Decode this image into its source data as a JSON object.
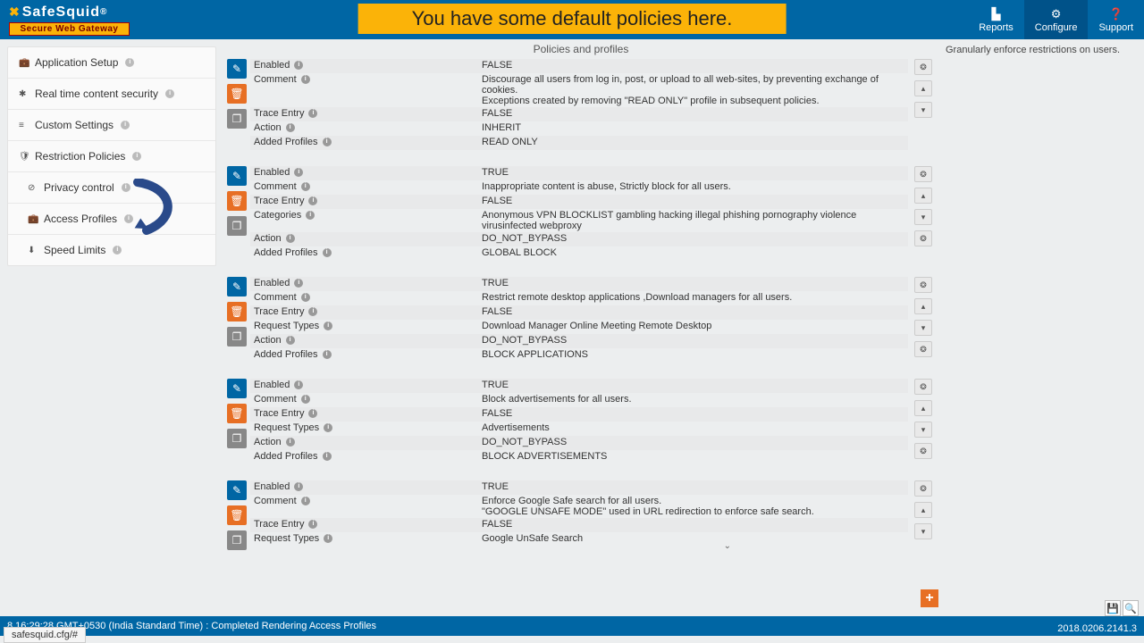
{
  "logo": {
    "name": "SafeSquid",
    "reg": "®",
    "sub": "Secure Web Gateway"
  },
  "banner": "You have some default policies here.",
  "topnav": {
    "reports": "Reports",
    "configure": "Configure",
    "support": "Support"
  },
  "sidebar": {
    "app_setup": "Application Setup",
    "realtime": "Real time content security",
    "custom": "Custom Settings",
    "restriction": "Restriction Policies",
    "privacy": "Privacy control",
    "access": "Access Profiles",
    "speed": "Speed Limits"
  },
  "content_title": "Policies and profiles",
  "right_note": "Granularly enforce restrictions on users.",
  "labels": {
    "enabled": "Enabled",
    "comment": "Comment",
    "trace": "Trace Entry",
    "action": "Action",
    "added": "Added Profiles",
    "categories": "Categories",
    "request_types": "Request Types"
  },
  "policies": [
    {
      "rows": [
        {
          "k": "enabled",
          "v": "FALSE",
          "g": true
        },
        {
          "k": "comment",
          "v": "Discourage all users from log in, post, or upload to all web-sites, by preventing exchange of cookies.\nExceptions created by removing \"READ ONLY\" profile in subsequent policies.",
          "g": false
        },
        {
          "k": "trace",
          "v": "FALSE",
          "g": true
        },
        {
          "k": "action",
          "v": "INHERIT",
          "g": false
        },
        {
          "k": "added",
          "v": "READ ONLY",
          "g": true
        }
      ],
      "side": [
        "cog",
        "up",
        "down"
      ]
    },
    {
      "rows": [
        {
          "k": "enabled",
          "v": "TRUE",
          "g": true
        },
        {
          "k": "comment",
          "v": "Inappropriate content is abuse, Strictly block for all users.",
          "g": false
        },
        {
          "k": "trace",
          "v": "FALSE",
          "g": true
        },
        {
          "k": "categories",
          "v": "Anonymous VPN  BLOCKLIST  gambling  hacking  illegal  phishing  pornography  violence  virusinfected  webproxy",
          "g": false
        },
        {
          "k": "action",
          "v": "DO_NOT_BYPASS",
          "g": true
        },
        {
          "k": "added",
          "v": "GLOBAL BLOCK",
          "g": false
        }
      ],
      "side": [
        "cog",
        "up",
        "down",
        "cog"
      ]
    },
    {
      "rows": [
        {
          "k": "enabled",
          "v": "TRUE",
          "g": true
        },
        {
          "k": "comment",
          "v": "Restrict remote desktop applications ,Download managers for all users.",
          "g": false
        },
        {
          "k": "trace",
          "v": "FALSE",
          "g": true
        },
        {
          "k": "request_types",
          "v": "Download Manager  Online Meeting  Remote Desktop",
          "g": false
        },
        {
          "k": "action",
          "v": "DO_NOT_BYPASS",
          "g": true
        },
        {
          "k": "added",
          "v": "BLOCK APPLICATIONS",
          "g": false
        }
      ],
      "side": [
        "cog",
        "up",
        "down",
        "cog"
      ]
    },
    {
      "rows": [
        {
          "k": "enabled",
          "v": "TRUE",
          "g": true
        },
        {
          "k": "comment",
          "v": "Block advertisements for all users.",
          "g": false
        },
        {
          "k": "trace",
          "v": "FALSE",
          "g": true
        },
        {
          "k": "request_types",
          "v": "Advertisements",
          "g": false
        },
        {
          "k": "action",
          "v": "DO_NOT_BYPASS",
          "g": true
        },
        {
          "k": "added",
          "v": "BLOCK ADVERTISEMENTS",
          "g": false
        }
      ],
      "side": [
        "cog",
        "up",
        "down",
        "cog"
      ]
    },
    {
      "rows": [
        {
          "k": "enabled",
          "v": "TRUE",
          "g": true
        },
        {
          "k": "comment",
          "v": "Enforce Google Safe search for all users.\n\"GOOGLE UNSAFE MODE\" used in URL redirection to enforce safe search.",
          "g": false
        },
        {
          "k": "trace",
          "v": "FALSE",
          "g": true
        },
        {
          "k": "request_types",
          "v": "Google UnSafe Search",
          "g": false
        }
      ],
      "side": [
        "cog",
        "up",
        "down"
      ]
    }
  ],
  "footer": {
    "status": "8 16:29:28 GMT+0530 (India Standard Time) : Completed Rendering Access Profiles",
    "link": "safesquid.cfg/#",
    "version": "2018.0206.2141.3"
  }
}
